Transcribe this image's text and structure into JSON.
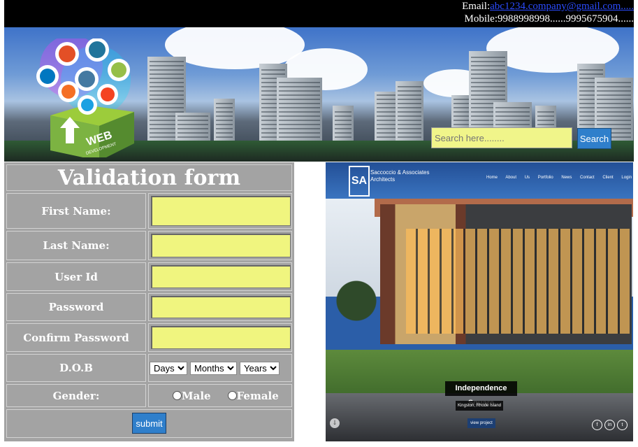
{
  "header": {
    "email_label": "Email:",
    "email_link": "abc1234.company@gmail.com.....",
    "mobile": "Mobile:9988998998......9995675904......"
  },
  "banner": {
    "logo_text_1": "WEB",
    "logo_text_2": "DEVELOPMENT",
    "search_placeholder": "Search here........",
    "search_button": "Search"
  },
  "form": {
    "title": "Validation form",
    "fields": {
      "first_name": "First Name:",
      "last_name": "Last Name:",
      "user_id": "User Id",
      "password": "Password",
      "confirm_password": "Confirm Password",
      "dob": "D.O.B",
      "gender": "Gender:"
    },
    "dob_selects": {
      "days": "Days",
      "months": "Months",
      "years": "Years"
    },
    "gender_options": {
      "male": "Male",
      "female": "Female"
    },
    "submit": "submit"
  },
  "photo": {
    "brand": "Saccoccio & Associates",
    "brand_sub": "Architects",
    "menu": "Home About Us Portfolio News Contact Client Login",
    "caption": "Independence Square",
    "caption_sub": "Kingston, Rhode Island",
    "caption_btn": "view project"
  },
  "colors": {
    "input_bg": "#f0f57f",
    "form_bg": "#a3a3a3",
    "button_bg": "#2f7fcb"
  }
}
